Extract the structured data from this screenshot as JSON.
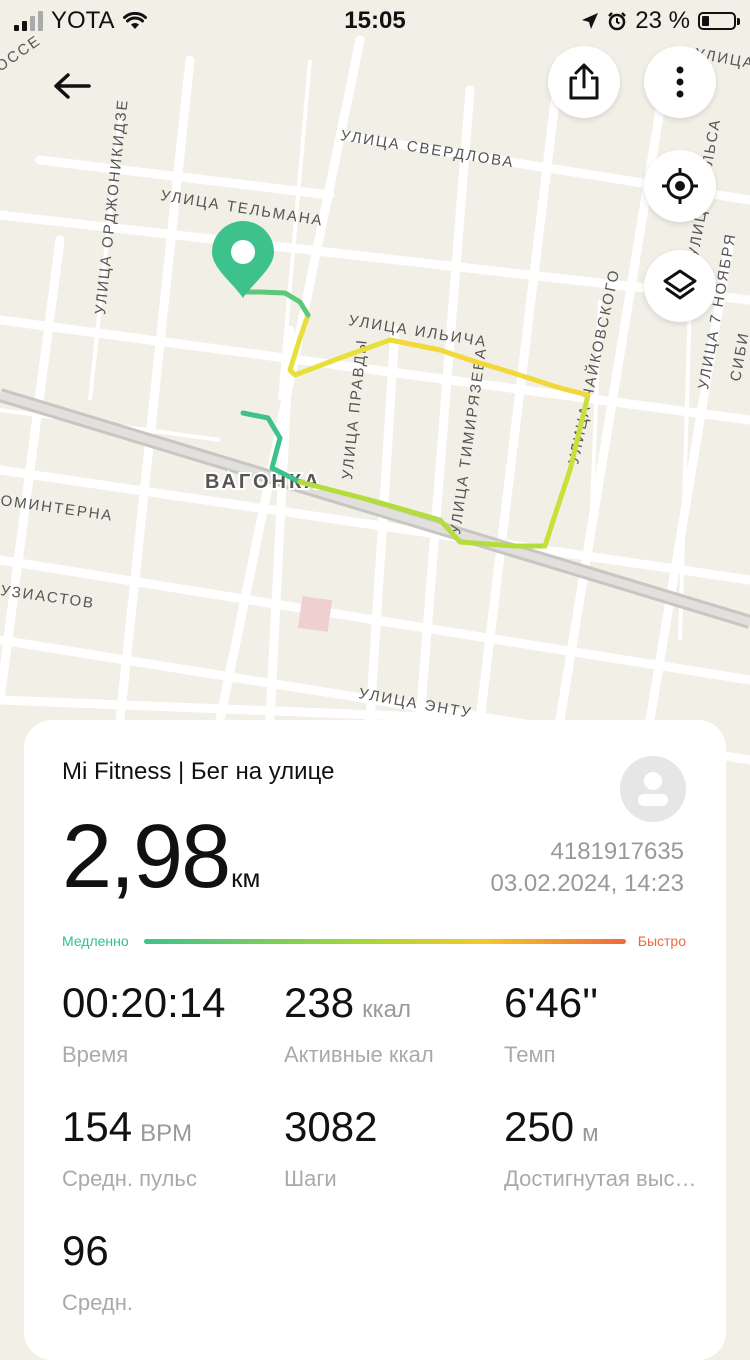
{
  "status_bar": {
    "carrier": "YOTA",
    "time": "15:05",
    "battery_percent": "23 %",
    "battery_level": 0.23
  },
  "map": {
    "street_labels": [
      "УЛИЦА СВЕРДЛОВА",
      "УЛИЦА ТЕЛЬМАНА",
      "УЛИЦА ОРДЖОНИКИДЗЕ",
      "УЛИЦА ИЛЬИЧА",
      "УЛИЦА ПРАВДЫ",
      "УЛИЦА ТИМИРЯЗЕВА",
      "УЛИЦА ЧАЙКОВСКОГО",
      "ОМИНТЕРНА",
      "УЗИАСТОВ",
      "УЛИЦА ЭНТУ",
      "ОССЕ",
      "УЛИЦА",
      "ЕЛЬСА",
      "УЛИЦА",
      "УЛИЦА 7 НОЯБРЯ",
      "СИБИ"
    ],
    "district_label": "ВАГОНКА",
    "route_colors": [
      "#3ec28c",
      "#a6d63a",
      "#f2d33a"
    ]
  },
  "card": {
    "source": "Mi Fitness | Бег на улице",
    "distance_value": "2,98",
    "distance_unit": "км",
    "workout_id": "4181917635",
    "datetime": "03.02.2024, 14:23",
    "pace_slow_label": "Медленно",
    "pace_fast_label": "Быстро",
    "stats": [
      {
        "value": "00:20:14",
        "unit": "",
        "label": "Время"
      },
      {
        "value": "238",
        "unit": "ккал",
        "label": "Активные ккал"
      },
      {
        "value": "6'46''",
        "unit": "",
        "label": "Темп"
      },
      {
        "value": "154",
        "unit": "BPM",
        "label": "Средн. пульс"
      },
      {
        "value": "3082",
        "unit": "",
        "label": "Шаги"
      },
      {
        "value": "250",
        "unit": "м",
        "label": "Достигнутая выс…"
      },
      {
        "value": "96",
        "unit": "",
        "label": "Средн."
      }
    ]
  }
}
